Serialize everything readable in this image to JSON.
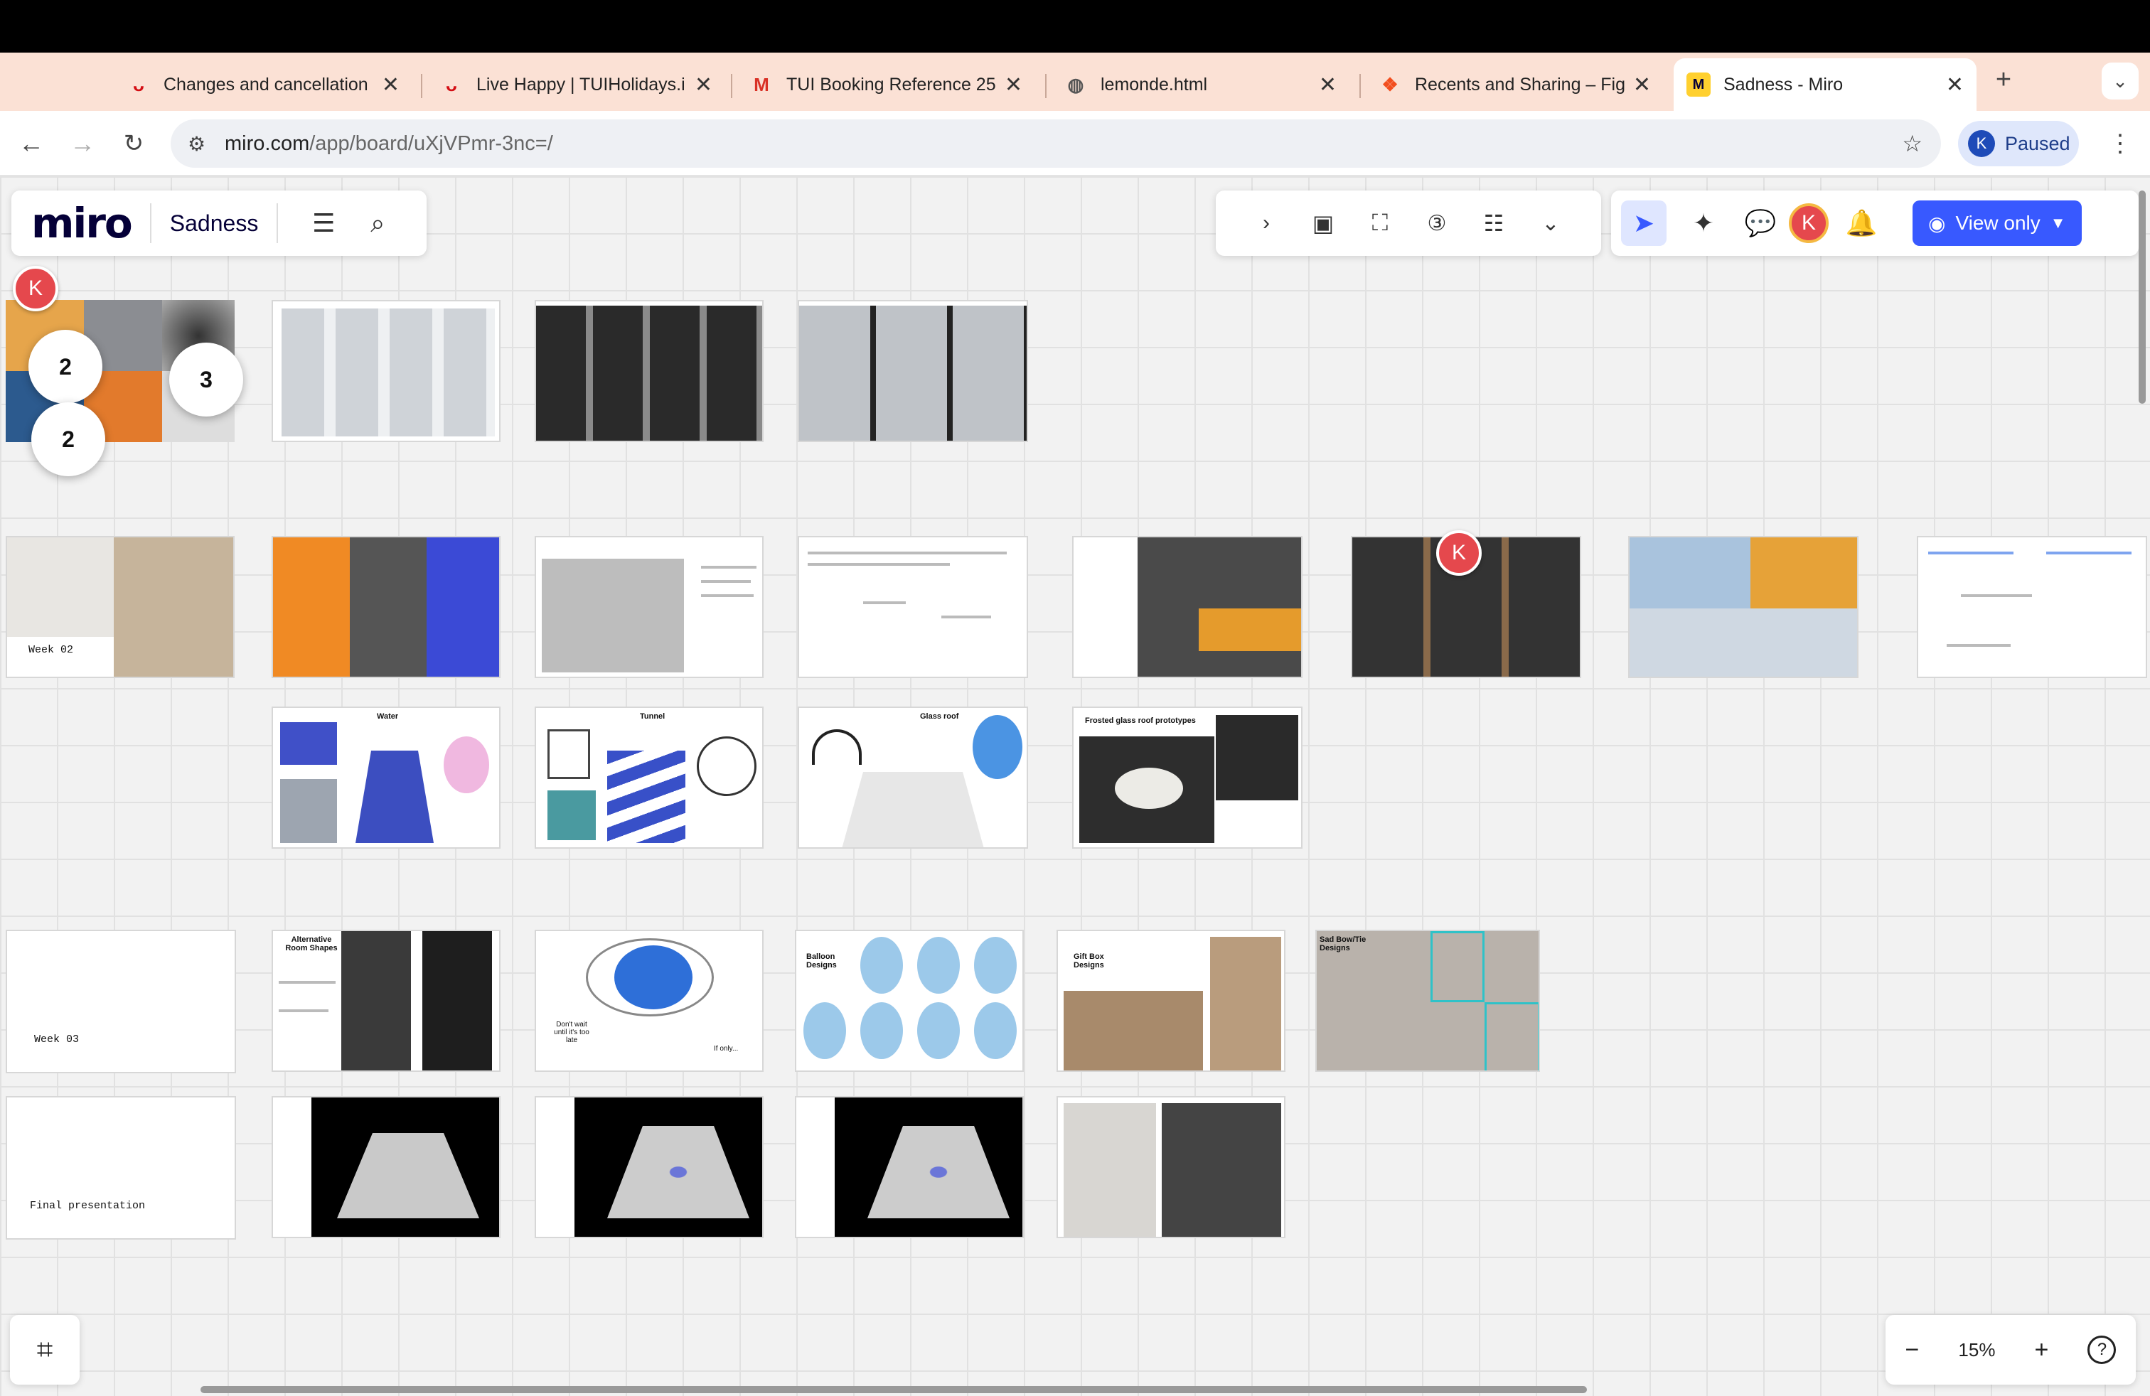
{
  "browser": {
    "tabs": [
      {
        "title": "Changes and cancellation",
        "icon": "tui-icon"
      },
      {
        "title": "Live Happy | TUIHolidays.i",
        "icon": "tui-icon"
      },
      {
        "title": "TUI Booking Reference 25",
        "icon": "gmail-icon"
      },
      {
        "title": "lemonde.html",
        "icon": "globe-icon"
      },
      {
        "title": "Recents and Sharing – Fig",
        "icon": "figma-icon"
      },
      {
        "title": "Sadness - Miro",
        "icon": "miro-icon"
      }
    ],
    "url_host": "miro.com",
    "url_path": "/app/board/uXjVPmr-3nc=/",
    "profile_initial": "K",
    "profile_status": "Paused"
  },
  "miro": {
    "logo": "miro",
    "board_name": "Sadness",
    "user_initial": "K",
    "view_only_label": "View only",
    "zoom_level": "15%",
    "accent_color": "#3859ff"
  },
  "board": {
    "frame_labels": {
      "week02": "Week 02",
      "week03": "Week 03",
      "final": "Final presentation"
    },
    "comment_counts": [
      "2",
      "3",
      "2"
    ],
    "collaborator_initial": "K",
    "card_titles": {
      "frosted": "Frosted glass roof prototypes",
      "alt_room": "Alternative Room Shapes",
      "balloon": "Balloon Designs",
      "gift_box": "Gift Box Designs",
      "sad_bow": "Sad Bow/Tie Designs",
      "water": "Water",
      "tunnel": "Tunnel",
      "glass_roof": "Glass roof"
    },
    "balloon_caption": "Don't wait until it's too late",
    "balloon_caption2": "If only..."
  }
}
